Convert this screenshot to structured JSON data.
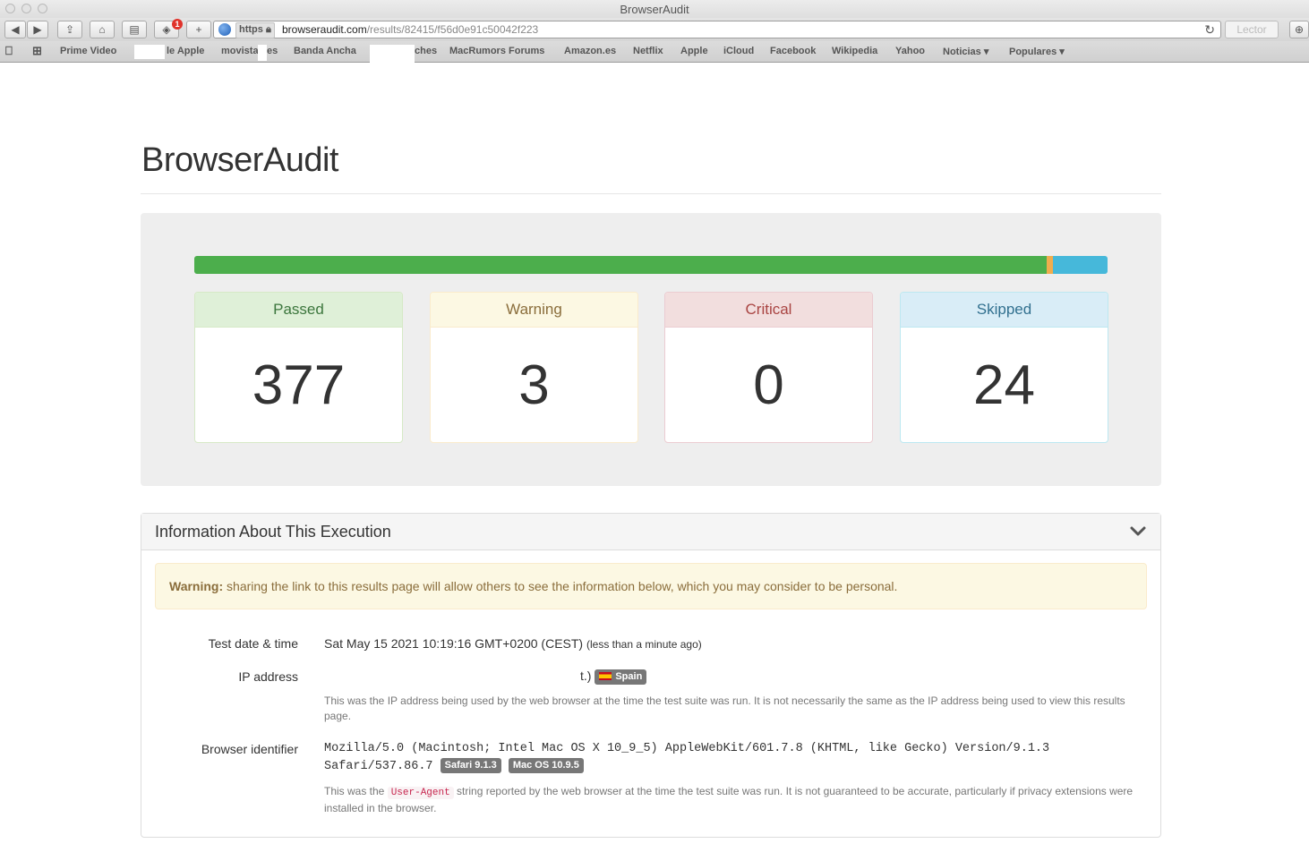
{
  "window": {
    "title": "BrowserAudit"
  },
  "toolbar": {
    "address": {
      "scheme_badge": "https",
      "host": "browseraudit.com",
      "path": "/results/82415/f56d0e91c50042f223"
    },
    "reader_label": "Lector",
    "extension_badge": "1"
  },
  "bookmarks": [
    "Prime Video",
    "le Apple",
    "movista",
    "es",
    "Banda Ancha",
    "ches",
    "MacRumors Forums",
    "Amazon.es",
    "Netflix",
    "Apple",
    "iCloud",
    "Facebook",
    "Wikipedia",
    "Yahoo",
    "Noticias ▾",
    "Populares ▾"
  ],
  "page": {
    "title": "BrowserAudit"
  },
  "summary": {
    "progress": {
      "passed_pct": 93.3,
      "warning_pct": 0.7,
      "skipped_pct": 6.0
    },
    "colors": {
      "passed": "#4cae4c",
      "warning": "#f0ad4e",
      "skipped": "#46b8da"
    },
    "cards": {
      "passed": {
        "label": "Passed",
        "value": "377"
      },
      "warning": {
        "label": "Warning",
        "value": "3"
      },
      "critical": {
        "label": "Critical",
        "value": "0"
      },
      "skipped": {
        "label": "Skipped",
        "value": "24"
      }
    }
  },
  "info": {
    "title": "Information About This Execution",
    "warning_strong": "Warning:",
    "warning_text": " sharing the link to this results page will allow others to see the information below, which you may consider to be personal.",
    "date": {
      "label": "Test date & time",
      "value": "Sat May 15 2021 10:19:16 GMT+0200 (CEST)",
      "relative": "(less than a minute ago)"
    },
    "ip": {
      "label": "IP address",
      "value": "t.)",
      "country": "Spain",
      "help": "This was the IP address being used by the web browser at the time the test suite was run. It is not necessarily the same as the IP address being used to view this results page."
    },
    "browser": {
      "label": "Browser identifier",
      "ua_line1": "Mozilla/5.0 (Macintosh; Intel Mac OS X 10_9_5) AppleWebKit/601.7.8 (KHTML, like Gecko) Version/9.1.3",
      "ua_line2": "Safari/537.86.7",
      "badge_browser": "Safari 9.1.3",
      "badge_os": "Mac OS 10.9.5",
      "help_before": "This was the ",
      "help_code": "User-Agent",
      "help_after": " string reported by the web browser at the time the test suite was run. It is not guaranteed to be accurate, particularly if privacy extensions were installed in the browser."
    }
  }
}
